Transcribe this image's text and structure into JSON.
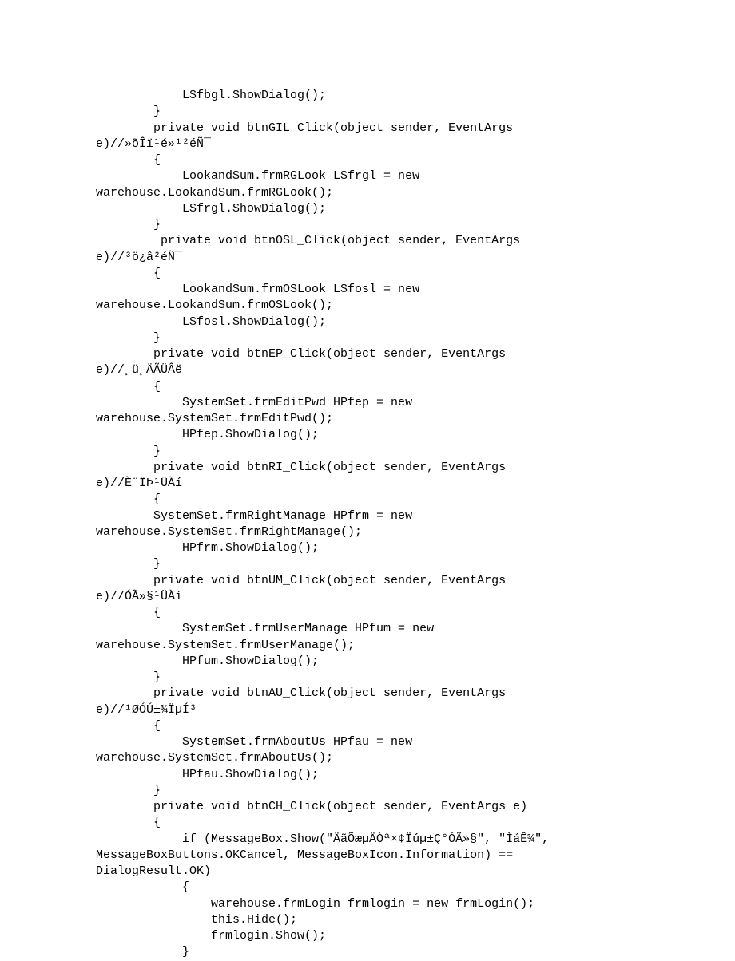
{
  "code": {
    "lines": [
      "            LSfbgl.ShowDialog();",
      "        }",
      "        private void btnGIL_Click(object sender, EventArgs",
      "e)//»õÎï¹é»¹²éÑ¯",
      "        {",
      "            LookandSum.frmRGLook LSfrgl = new",
      "warehouse.LookandSum.frmRGLook();",
      "            LSfrgl.ShowDialog();",
      "        }",
      "         private void btnOSL_Click(object sender, EventArgs",
      "e)//³ö¿â²éÑ¯",
      "        {",
      "            LookandSum.frmOSLook LSfosl = new",
      "warehouse.LookandSum.frmOSLook();",
      "            LSfosl.ShowDialog();",
      "        }",
      "        private void btnEP_Click(object sender, EventArgs",
      "e)//¸ü¸ÄÃÜÂë",
      "        {",
      "            SystemSet.frmEditPwd HPfep = new",
      "warehouse.SystemSet.frmEditPwd();",
      "            HPfep.ShowDialog();",
      "        }",
      "        private void btnRI_Click(object sender, EventArgs",
      "e)//È¨ÏÞ¹ÜÀí",
      "        {",
      "        SystemSet.frmRightManage HPfrm = new",
      "warehouse.SystemSet.frmRightManage();",
      "            HPfrm.ShowDialog();",
      "        }",
      "        private void btnUM_Click(object sender, EventArgs",
      "e)//ÓÃ»§¹ÜÀí",
      "        {",
      "            SystemSet.frmUserManage HPfum = new",
      "warehouse.SystemSet.frmUserManage();",
      "            HPfum.ShowDialog();",
      "        }",
      "        private void btnAU_Click(object sender, EventArgs",
      "e)//¹ØÓÚ±¾ÏµÍ³",
      "        {",
      "            SystemSet.frmAboutUs HPfau = new",
      "warehouse.SystemSet.frmAboutUs();",
      "            HPfau.ShowDialog();",
      "        }",
      "        private void btnCH_Click(object sender, EventArgs e)",
      "        {",
      "            if (MessageBox.Show(\"ÄãÕæµÄÒª×¢Ïúµ±Ç°ÓÃ»§\", \"ÌáÊ¾\",",
      "MessageBoxButtons.OKCancel, MessageBoxIcon.Information) ==",
      "DialogResult.OK)",
      "            {",
      "                warehouse.frmLogin frmlogin = new frmLogin();",
      "                this.Hide();",
      "                frmlogin.Show();",
      "            }"
    ]
  }
}
